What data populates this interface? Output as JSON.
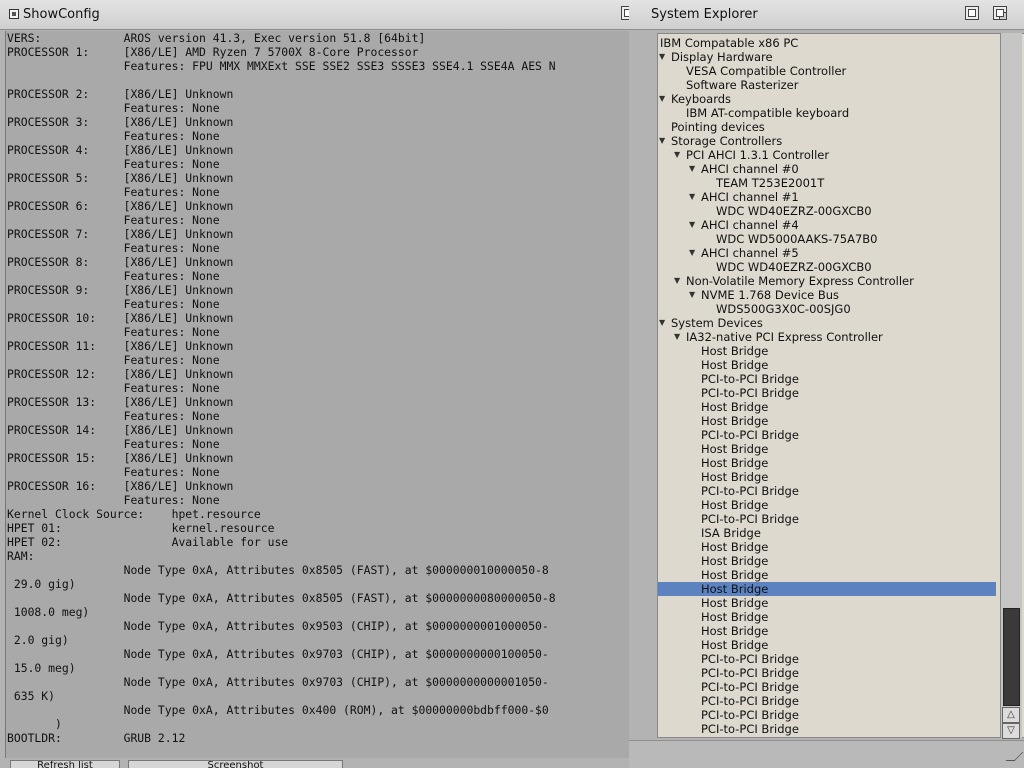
{
  "showconfig": {
    "title": "ShowConfig",
    "lines": [
      "VERS:            AROS version 41.3, Exec version 51.8 [64bit]",
      "PROCESSOR 1:     [X86/LE] AMD Ryzen 7 5700X 8-Core Processor",
      "                 Features: FPU MMX MMXExt SSE SSE2 SSE3 SSSE3 SSE4.1 SSE4A AES N",
      "",
      "PROCESSOR 2:     [X86/LE] Unknown",
      "                 Features: None",
      "PROCESSOR 3:     [X86/LE] Unknown",
      "                 Features: None",
      "PROCESSOR 4:     [X86/LE] Unknown",
      "                 Features: None",
      "PROCESSOR 5:     [X86/LE] Unknown",
      "                 Features: None",
      "PROCESSOR 6:     [X86/LE] Unknown",
      "                 Features: None",
      "PROCESSOR 7:     [X86/LE] Unknown",
      "                 Features: None",
      "PROCESSOR 8:     [X86/LE] Unknown",
      "                 Features: None",
      "PROCESSOR 9:     [X86/LE] Unknown",
      "                 Features: None",
      "PROCESSOR 10:    [X86/LE] Unknown",
      "                 Features: None",
      "PROCESSOR 11:    [X86/LE] Unknown",
      "                 Features: None",
      "PROCESSOR 12:    [X86/LE] Unknown",
      "                 Features: None",
      "PROCESSOR 13:    [X86/LE] Unknown",
      "                 Features: None",
      "PROCESSOR 14:    [X86/LE] Unknown",
      "                 Features: None",
      "PROCESSOR 15:    [X86/LE] Unknown",
      "                 Features: None",
      "PROCESSOR 16:    [X86/LE] Unknown",
      "                 Features: None",
      "Kernel Clock Source:    hpet.resource",
      "HPET 01:                kernel.resource",
      "HPET 02:                Available for use",
      "RAM:",
      "                 Node Type 0xA, Attributes 0x8505 (FAST), at $000000010000050-8",
      " 29.0 gig)",
      "                 Node Type 0xA, Attributes 0x8505 (FAST), at $0000000080000050-8",
      " 1008.0 meg)",
      "                 Node Type 0xA, Attributes 0x9503 (CHIP), at $0000000001000050-",
      " 2.0 gig)",
      "                 Node Type 0xA, Attributes 0x9703 (CHIP), at $0000000000100050-",
      " 15.0 meg)",
      "                 Node Type 0xA, Attributes 0x9703 (CHIP), at $0000000000001050-",
      " 635 K)",
      "                 Node Type 0xA, Attributes 0x400 (ROM), at $00000000bdbff000-$0",
      "       )",
      "BOOTLDR:         GRUB 2.12"
    ]
  },
  "system_explorer": {
    "title": "System Explorer",
    "tree": [
      {
        "label": "IBM Compatable x86 PC",
        "level": 0,
        "expanded": null,
        "selected": false
      },
      {
        "label": "Display Hardware",
        "level": 1,
        "expanded": true,
        "selected": false
      },
      {
        "label": "VESA Compatible Controller",
        "level": 2,
        "expanded": null,
        "selected": false
      },
      {
        "label": "Software Rasterizer",
        "level": 2,
        "expanded": null,
        "selected": false
      },
      {
        "label": "Keyboards",
        "level": 1,
        "expanded": true,
        "selected": false
      },
      {
        "label": "IBM AT-compatible keyboard",
        "level": 2,
        "expanded": null,
        "selected": false
      },
      {
        "label": "Pointing devices",
        "level": 1,
        "expanded": null,
        "selected": false
      },
      {
        "label": "Storage Controllers",
        "level": 1,
        "expanded": true,
        "selected": false
      },
      {
        "label": "PCI AHCI 1.3.1 Controller",
        "level": 2,
        "expanded": true,
        "selected": false
      },
      {
        "label": "AHCI channel #0",
        "level": 3,
        "expanded": true,
        "selected": false
      },
      {
        "label": "TEAM T253E2001T",
        "level": 4,
        "expanded": null,
        "selected": false
      },
      {
        "label": "AHCI channel #1",
        "level": 3,
        "expanded": true,
        "selected": false
      },
      {
        "label": "WDC WD40EZRZ-00GXCB0",
        "level": 4,
        "expanded": null,
        "selected": false
      },
      {
        "label": "AHCI channel #4",
        "level": 3,
        "expanded": true,
        "selected": false
      },
      {
        "label": "WDC WD5000AAKS-75A7B0",
        "level": 4,
        "expanded": null,
        "selected": false
      },
      {
        "label": "AHCI channel #5",
        "level": 3,
        "expanded": true,
        "selected": false
      },
      {
        "label": "WDC WD40EZRZ-00GXCB0",
        "level": 4,
        "expanded": null,
        "selected": false
      },
      {
        "label": "Non-Volatile Memory Express Controller",
        "level": 2,
        "expanded": true,
        "selected": false
      },
      {
        "label": "NVME 1.768 Device Bus",
        "level": 3,
        "expanded": true,
        "selected": false
      },
      {
        "label": "WDS500G3X0C-00SJG0",
        "level": 4,
        "expanded": null,
        "selected": false
      },
      {
        "label": "System Devices",
        "level": 1,
        "expanded": true,
        "selected": false
      },
      {
        "label": "IA32-native PCI Express Controller",
        "level": 2,
        "expanded": true,
        "selected": false
      },
      {
        "label": "Host Bridge",
        "level": 3,
        "expanded": null,
        "selected": false
      },
      {
        "label": "Host Bridge",
        "level": 3,
        "expanded": null,
        "selected": false
      },
      {
        "label": "PCI-to-PCI Bridge",
        "level": 3,
        "expanded": null,
        "selected": false
      },
      {
        "label": "PCI-to-PCI Bridge",
        "level": 3,
        "expanded": null,
        "selected": false
      },
      {
        "label": "Host Bridge",
        "level": 3,
        "expanded": null,
        "selected": false
      },
      {
        "label": "Host Bridge",
        "level": 3,
        "expanded": null,
        "selected": false
      },
      {
        "label": "PCI-to-PCI Bridge",
        "level": 3,
        "expanded": null,
        "selected": false
      },
      {
        "label": "Host Bridge",
        "level": 3,
        "expanded": null,
        "selected": false
      },
      {
        "label": "Host Bridge",
        "level": 3,
        "expanded": null,
        "selected": false
      },
      {
        "label": "Host Bridge",
        "level": 3,
        "expanded": null,
        "selected": false
      },
      {
        "label": "PCI-to-PCI Bridge",
        "level": 3,
        "expanded": null,
        "selected": false
      },
      {
        "label": "Host Bridge",
        "level": 3,
        "expanded": null,
        "selected": false
      },
      {
        "label": "PCI-to-PCI Bridge",
        "level": 3,
        "expanded": null,
        "selected": false
      },
      {
        "label": "ISA Bridge",
        "level": 3,
        "expanded": null,
        "selected": false
      },
      {
        "label": "Host Bridge",
        "level": 3,
        "expanded": null,
        "selected": false
      },
      {
        "label": "Host Bridge",
        "level": 3,
        "expanded": null,
        "selected": false
      },
      {
        "label": "Host Bridge",
        "level": 3,
        "expanded": null,
        "selected": false
      },
      {
        "label": "Host Bridge",
        "level": 3,
        "expanded": null,
        "selected": true
      },
      {
        "label": "Host Bridge",
        "level": 3,
        "expanded": null,
        "selected": false
      },
      {
        "label": "Host Bridge",
        "level": 3,
        "expanded": null,
        "selected": false
      },
      {
        "label": "Host Bridge",
        "level": 3,
        "expanded": null,
        "selected": false
      },
      {
        "label": "Host Bridge",
        "level": 3,
        "expanded": null,
        "selected": false
      },
      {
        "label": "PCI-to-PCI Bridge",
        "level": 3,
        "expanded": null,
        "selected": false
      },
      {
        "label": "PCI-to-PCI Bridge",
        "level": 3,
        "expanded": null,
        "selected": false
      },
      {
        "label": "PCI-to-PCI Bridge",
        "level": 3,
        "expanded": null,
        "selected": false
      },
      {
        "label": "PCI-to-PCI Bridge",
        "level": 3,
        "expanded": null,
        "selected": false
      },
      {
        "label": "PCI-to-PCI Bridge",
        "level": 3,
        "expanded": null,
        "selected": false
      },
      {
        "label": "PCI-to-PCI Bridge",
        "level": 3,
        "expanded": null,
        "selected": false
      }
    ]
  },
  "bottom_buttons": {
    "refresh": "Refresh list",
    "screenshot": "Screenshot"
  },
  "icons": {
    "expanded": "▼",
    "collapsed": "▶",
    "scroll_up": "△",
    "scroll_down": "▽"
  },
  "colors": {
    "selection": "#5c82c0",
    "text_bg": "#a9a9a9",
    "tree_bg": "#ddd9cf"
  }
}
